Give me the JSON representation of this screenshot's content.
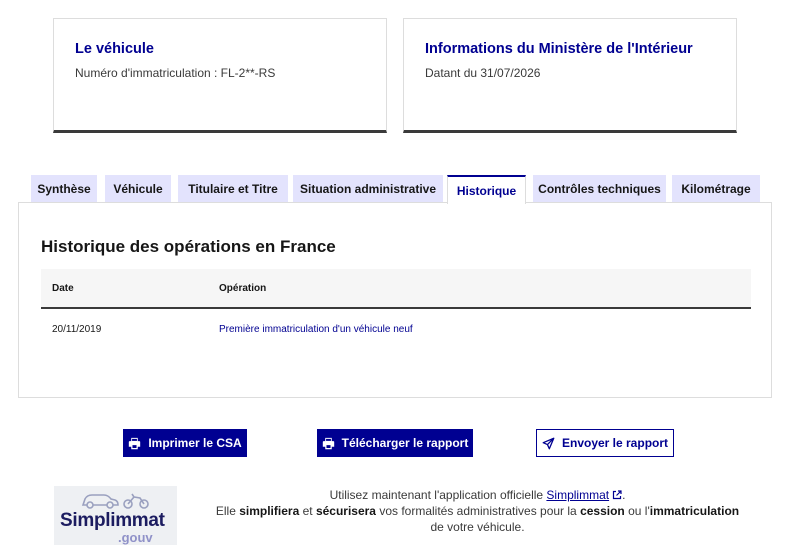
{
  "vehicle_card": {
    "title": "Le véhicule",
    "plate_line": "Numéro d'immatriculation : FL-2**-RS"
  },
  "ministry_card": {
    "title": "Informations du Ministère de l'Intérieur",
    "date_line": "Datant du 31/07/2026"
  },
  "tabs": [
    {
      "label": "Synthèse",
      "active": false
    },
    {
      "label": "Véhicule",
      "active": false
    },
    {
      "label": "Titulaire et Titre",
      "active": false
    },
    {
      "label": "Situation administrative",
      "active": false
    },
    {
      "label": "Historique",
      "active": true
    },
    {
      "label": "Contrôles techniques",
      "active": false
    },
    {
      "label": "Kilométrage",
      "active": false
    }
  ],
  "history": {
    "title": "Historique des opérations en France",
    "columns": [
      "Date",
      "Opération"
    ],
    "rows": [
      {
        "date": "20/11/2019",
        "operation": "Première immatriculation d'un véhicule neuf"
      }
    ]
  },
  "actions": {
    "print_label": "Imprimer le CSA",
    "download_label": "Télécharger le rapport",
    "send_label": "Envoyer le rapport"
  },
  "promo": {
    "logo_main": "Simplimmat",
    "logo_sub": ".gouv",
    "line1_prefix": "Utilisez maintenant l'application officielle ",
    "link_label": "Simplimmat",
    "line1_suffix": ".",
    "line2_a": "Elle ",
    "line2_b": "simplifiera",
    "line2_c": " et ",
    "line2_d": "sécurisera",
    "line2_e": " vos formalités administratives pour la ",
    "line2_f": "cession",
    "line2_g": " ou l'",
    "line2_h": "immatriculation",
    "line2_i": " de votre véhicule."
  },
  "colors": {
    "primary": "#000091",
    "tab_bg": "#e3e3fd",
    "border_dark": "#3a3a3a"
  },
  "icons": {
    "print": "printer-icon",
    "send": "paper-plane-icon",
    "external": "external-link-icon"
  }
}
